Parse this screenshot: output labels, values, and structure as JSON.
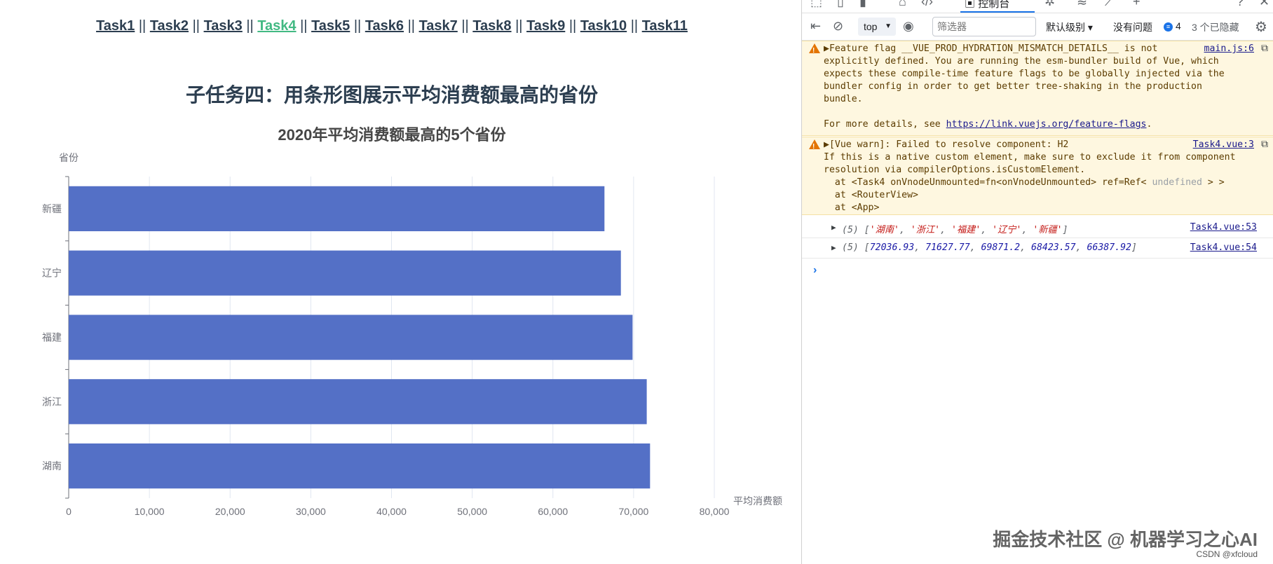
{
  "nav": {
    "tasks": [
      "Task1",
      "Task2",
      "Task3",
      "Task4",
      "Task5",
      "Task6",
      "Task7",
      "Task8",
      "Task9",
      "Task10",
      "Task11"
    ],
    "active_index": 3,
    "separator": "||",
    "active_color": "#42b983"
  },
  "page": {
    "heading": "子任务四：用条形图展示平均消费额最高的省份"
  },
  "chart_data": {
    "type": "bar",
    "orientation": "horizontal",
    "title": "2020年平均消费额最高的5个省份",
    "xlabel": "平均消费额",
    "ylabel": "省份",
    "categories": [
      "湖南",
      "浙江",
      "福建",
      "辽宁",
      "新疆"
    ],
    "values": [
      72036.93,
      71627.77,
      69871.2,
      68423.57,
      66387.92
    ],
    "xlim": [
      0,
      80000
    ],
    "xticks": [
      "0",
      "10,000",
      "20,000",
      "30,000",
      "40,000",
      "50,000",
      "60,000",
      "70,000",
      "80,000"
    ],
    "grid": true,
    "bar_color": "#5470c6"
  },
  "devtools": {
    "console_tab": "控制台",
    "context": "top",
    "filter_placeholder": "筛选器",
    "level": "默认级别",
    "issues": "没有问题",
    "message_count": "4",
    "hidden": "3 个已隐藏",
    "warnings": [
      {
        "lines": [
          "Feature flag __VUE_PROD_HYDRATION_MISMATCH_DETAILS__ is not",
          "explicitly defined. You are running the esm-bundler build of Vue, which",
          "expects these compile-time feature flags to be globally injected via the",
          "bundler config in order to get better tree-shaking in the production",
          "bundle.",
          "",
          "For more details, see "
        ],
        "link_text": "https://link.vuejs.org/feature-flags",
        "source": "main.js:6"
      },
      {
        "lines": [
          "[Vue warn]: Failed to resolve component: H2",
          "If this is a native custom element, make sure to exclude it from component",
          "resolution via compilerOptions.isCustomElement.",
          "  at <Task4 onVnodeUnmounted=fn<onVnodeUnmounted> ref=Ref< ",
          "  at <RouterView>",
          "  at <App>"
        ],
        "undefined_text": "undefined",
        "ref_tail": " > >",
        "source": "Task4.vue:3"
      }
    ],
    "logs": [
      {
        "count": "(5)",
        "items": [
          "'湖南'",
          "'浙江'",
          "'福建'",
          "'辽宁'",
          "'新疆'"
        ],
        "kind": "str",
        "source": "Task4.vue:53"
      },
      {
        "count": "(5)",
        "items": [
          "72036.93",
          "71627.77",
          "69871.2",
          "68423.57",
          "66387.92"
        ],
        "kind": "num",
        "source": "Task4.vue:54"
      }
    ]
  },
  "watermark": "掘金技术社区 @ 机器学习之心AI",
  "csdn": "CSDN @xfcloud"
}
